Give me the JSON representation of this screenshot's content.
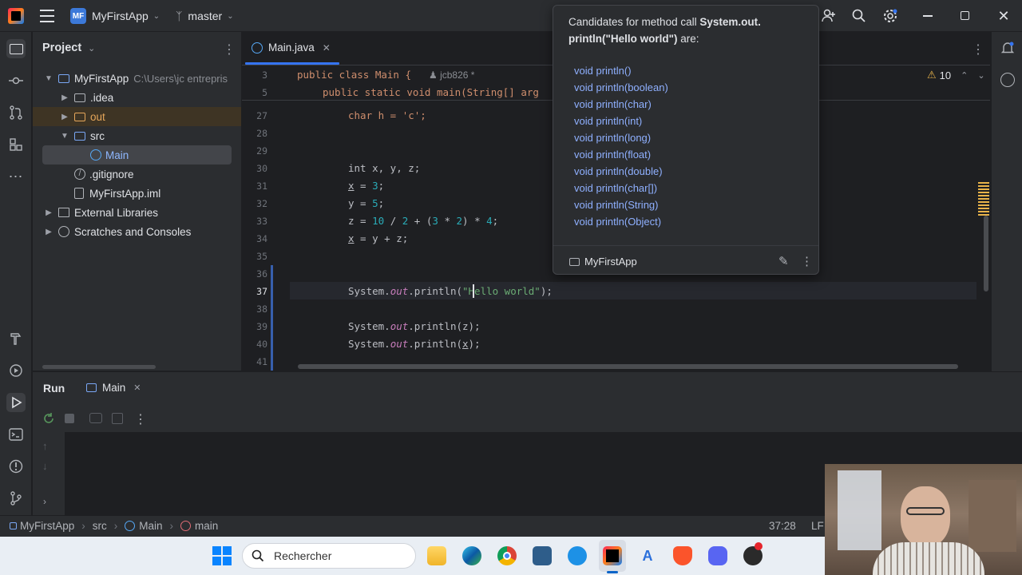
{
  "titlebar": {
    "app_initials": "MF",
    "project_name": "MyFirstApp",
    "branch": "master"
  },
  "project_panel": {
    "title": "Project",
    "root_name": "MyFirstApp",
    "root_path": "C:\\Users\\jc entrepris",
    "items": [
      {
        "label": ".idea"
      },
      {
        "label": "out"
      },
      {
        "label": "src"
      },
      {
        "label": "Main"
      },
      {
        "label": ".gitignore"
      },
      {
        "label": "MyFirstApp.iml"
      },
      {
        "label": "External Libraries"
      },
      {
        "label": "Scratches and Consoles"
      }
    ]
  },
  "editor": {
    "tab_label": "Main.java",
    "warning_count": "10",
    "author": "jcb826 *",
    "sticky": [
      {
        "ln": "3",
        "text": "public class Main {"
      },
      {
        "ln": "5",
        "text": "public static void main(String[] arg"
      }
    ],
    "lines": [
      {
        "ln": "27"
      },
      {
        "ln": "28"
      },
      {
        "ln": "29"
      },
      {
        "ln": "30"
      },
      {
        "ln": "31"
      },
      {
        "ln": "32"
      },
      {
        "ln": "33"
      },
      {
        "ln": "34"
      },
      {
        "ln": "35"
      },
      {
        "ln": "36"
      },
      {
        "ln": "37"
      },
      {
        "ln": "38"
      },
      {
        "ln": "39"
      },
      {
        "ln": "40"
      },
      {
        "ln": "41"
      }
    ],
    "code": {
      "l27": "char h = 'c';",
      "l30": "int x, y, z;",
      "l31a": "x",
      "l31b": " = ",
      "l31c": "3",
      "l31d": ";",
      "l32a": "y = ",
      "l32b": "5",
      "l32c": ";",
      "l33a": "z = ",
      "l33b": "10",
      "l33c": " / ",
      "l33d": "2",
      "l33e": " + (",
      "l33f": "3",
      "l33g": " * ",
      "l33h": "2",
      "l33i": ") * ",
      "l33j": "4",
      "l33k": ";",
      "l34a": "x",
      "l34b": " = y + z;",
      "l37a": "System.",
      "l37b": "out",
      "l37c": ".println(",
      "l37d": "\"Hello world\"",
      "l37e": ");",
      "l39a": "System.",
      "l39b": "out",
      "l39c": ".println(z);",
      "l40a": "System.",
      "l40b": "out",
      "l40c": ".println(",
      "l40d": "x",
      "l40e": ");"
    }
  },
  "popup": {
    "heading_pre": "Candidates for method call ",
    "heading_bold1": "System.out.",
    "heading_bold2": "println(\"Hello world\")",
    "heading_post": " are:",
    "candidates": [
      "void println()",
      "void println(boolean)",
      "void println(char)",
      "void println(int)",
      "void println(long)",
      "void println(float)",
      "void println(double)",
      "void println(char[])",
      "void println(String)",
      "void println(Object)"
    ],
    "footer_project": "MyFirstApp"
  },
  "run_panel": {
    "title": "Run",
    "tab_label": "Main"
  },
  "statusbar": {
    "crumbs": [
      "MyFirstApp",
      "src",
      "Main",
      "main"
    ],
    "position": "37:28",
    "line_ending": "LF"
  },
  "taskbar": {
    "search_placeholder": "Rechercher"
  },
  "colors": {
    "accent": "#3574f0",
    "folder_out": "#e5a65a",
    "selection": "#43454a"
  }
}
